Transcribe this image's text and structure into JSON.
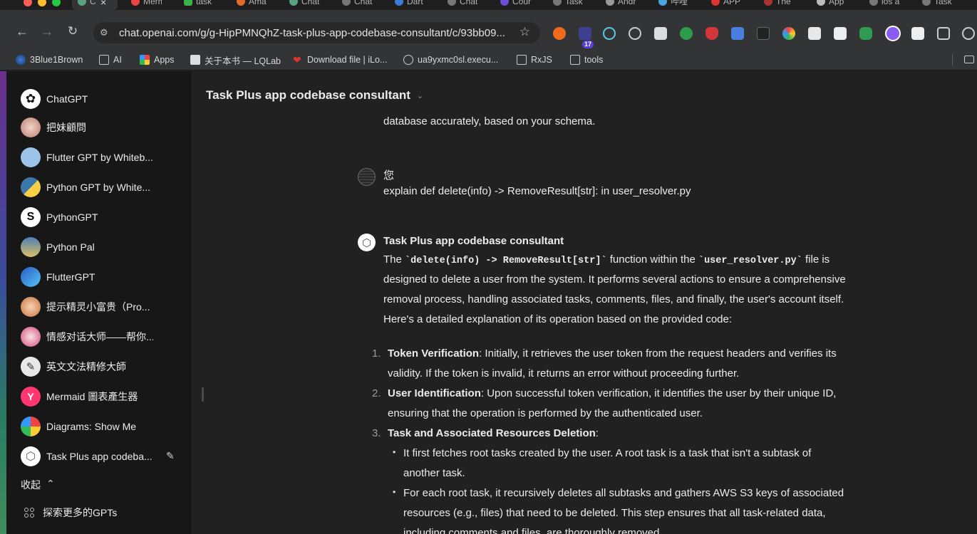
{
  "browser": {
    "tabs": [
      {
        "label": "C"
      },
      {
        "label": "Merm"
      },
      {
        "label": "task"
      },
      {
        "label": "Ama"
      },
      {
        "label": "Chat"
      },
      {
        "label": "Chat"
      },
      {
        "label": "Dart"
      },
      {
        "label": "Chat"
      },
      {
        "label": "Cour"
      },
      {
        "label": "Task"
      },
      {
        "label": "Andr"
      },
      {
        "label": "哔哩"
      },
      {
        "label": "APP"
      },
      {
        "label": "The"
      },
      {
        "label": "App"
      },
      {
        "label": "ios a"
      },
      {
        "label": "Task"
      }
    ],
    "url": "chat.openai.com/g/g-HipPMNQhZ-task-plus-app-codebase-consultant/c/93bb09...",
    "extension_badge": "17",
    "bookmarks": [
      {
        "label": "3Blue1Brown",
        "icon": "3b1b-icon"
      },
      {
        "label": "AI",
        "icon": "folder-icon"
      },
      {
        "label": "Apps",
        "icon": "apps-grid-icon"
      },
      {
        "label": "关于本书 — LQLab",
        "icon": "book-icon"
      },
      {
        "label": "Download file | iLo...",
        "icon": "heart-icon"
      },
      {
        "label": "ua9yxmc0sl.execu...",
        "icon": "globe-icon"
      },
      {
        "label": "RxJS",
        "icon": "folder-icon"
      },
      {
        "label": "tools",
        "icon": "folder-icon"
      }
    ]
  },
  "sidebar": {
    "items": [
      {
        "label": "ChatGPT",
        "icon": "openai-logo-icon"
      },
      {
        "label": "把妹顧問",
        "icon": "avatar-image"
      },
      {
        "label": "Flutter GPT by Whiteb...",
        "icon": "avatar-image"
      },
      {
        "label": "Python GPT by White...",
        "icon": "python-logo-icon"
      },
      {
        "label": "PythonGPT",
        "icon": "avatar-image"
      },
      {
        "label": "Python Pal",
        "icon": "avatar-image"
      },
      {
        "label": "FlutterGPT",
        "icon": "flutter-logo-icon"
      },
      {
        "label": "提示精灵小富贵（Pro...",
        "icon": "avatar-image"
      },
      {
        "label": "情感对话大师——帮你...",
        "icon": "avatar-image"
      },
      {
        "label": "英文文法精修大師",
        "icon": "avatar-image"
      },
      {
        "label": "Mermaid 圖表產生器",
        "icon": "mermaid-logo-icon"
      },
      {
        "label": "Diagrams: Show Me",
        "icon": "avatar-image"
      },
      {
        "label": "Task Plus app codeba...",
        "icon": "cube-icon"
      }
    ],
    "collapse_label": "收起",
    "explore_label": "探索更多的GPTs"
  },
  "main": {
    "title": "Task Plus app codebase consultant",
    "prev_tail": "database accurately, based on your schema.",
    "user_name": "您",
    "user_message": "explain def delete(info) -> RemoveResult[str]:  in user_resolver.py",
    "bot_name": "Task Plus app codebase consultant",
    "intro": {
      "p1": "The ",
      "code1": "`delete(info) -> RemoveResult[str]`",
      "p2": " function within the ",
      "code2": "`user_resolver.py`",
      "p3": " file is",
      "line2": "designed to delete a user from the system. It performs several actions to ensure a comprehensive",
      "line3": "removal process, handling associated tasks, comments, files, and finally, the user's account itself.",
      "line4": "Here's a detailed explanation of its operation based on the provided code:"
    },
    "steps": [
      {
        "num": "1.",
        "title": "Token Verification",
        "l1": ": Initially, it retrieves the user token from the request headers and verifies its",
        "l2": "validity. If the token is invalid, it returns an error without proceeding further."
      },
      {
        "num": "2.",
        "title": "User Identification",
        "l1": ": Upon successful token verification, it identifies the user by their unique ID,",
        "l2": "ensuring that the operation is performed by the authenticated user."
      },
      {
        "num": "3.",
        "title": "Task and Associated Resources Deletion",
        "l1": ":",
        "l2": ""
      }
    ],
    "bullets": [
      {
        "l1": "It first fetches root tasks created by the user. A root task is a task that isn't a subtask of",
        "l2": "another task."
      },
      {
        "l1": "For each root task, it recursively deletes all subtasks and gathers AWS S3 keys of associated",
        "l2": "resources (e.g., files) that need to be deleted. This step ensures that all task-related data,",
        "l3": "including comments and files, are thoroughly removed."
      }
    ]
  }
}
